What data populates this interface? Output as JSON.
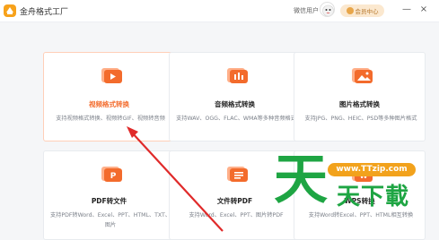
{
  "app": {
    "title": "金舟格式工厂",
    "user": "微信用户",
    "vip_label": "会员中心",
    "minimize_glyph": "—",
    "close_glyph": "×"
  },
  "cards": [
    {
      "title": "视频格式转换",
      "desc": "支持视频格式转换、视频转GIF、视频转音频",
      "icon": "video-convert-icon"
    },
    {
      "title": "音频格式转换",
      "desc": "支持WAV、OGG、FLAC、WMA等多种音频格式",
      "icon": "audio-convert-icon"
    },
    {
      "title": "图片格式转换",
      "desc": "支持JPG、PNG、HEIC、PSD等多种图片格式",
      "icon": "image-convert-icon"
    },
    {
      "title": "PDF转文件",
      "desc": "支持PDF转Word、Excel、PPT、HTML、TXT、图片",
      "icon": "pdf-to-file-icon"
    },
    {
      "title": "文件转PDF",
      "desc": "支持Word、Excel、PPT、图片转PDF",
      "icon": "file-to-pdf-icon"
    },
    {
      "title": "WPS转换",
      "desc": "支持Word转Excel、PPT、HTML相互转换",
      "icon": "wps-convert-icon"
    }
  ],
  "watermark": {
    "url": "www.TTzip.com",
    "big_char": "天",
    "small_text": "天下載"
  },
  "colors": {
    "accent": "#f36b2c",
    "vip_bg": "#fbe8cf",
    "watermark_green": "#1ea543",
    "watermark_orange": "#f2a21c"
  }
}
